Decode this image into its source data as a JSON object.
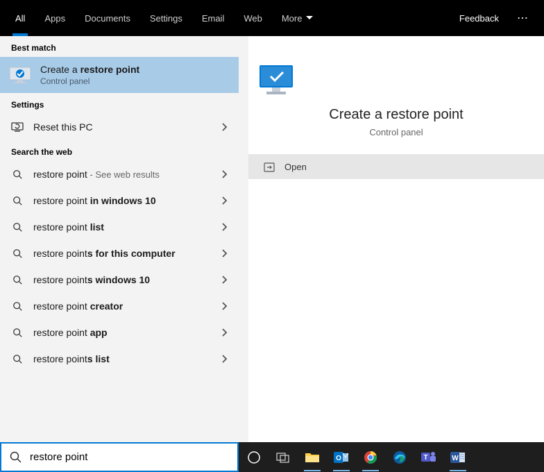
{
  "nav": {
    "tabs": [
      "All",
      "Apps",
      "Documents",
      "Settings",
      "Email",
      "Web",
      "More"
    ],
    "feedback": "Feedback"
  },
  "left": {
    "best_match_header": "Best match",
    "best_match": {
      "title_pre": "Create a ",
      "title_bold": "restore point",
      "subtitle": "Control panel"
    },
    "settings_header": "Settings",
    "settings_items": [
      {
        "label": "Reset this PC"
      }
    ],
    "web_header": "Search the web",
    "web_items": [
      {
        "pre": "restore point",
        "bold": "",
        "sub": " - See web results"
      },
      {
        "pre": "restore point ",
        "bold": "in windows 10",
        "sub": ""
      },
      {
        "pre": "restore point ",
        "bold": "list",
        "sub": ""
      },
      {
        "pre": "restore point",
        "bold": "s for this computer",
        "sub": ""
      },
      {
        "pre": "restore point",
        "bold": "s windows 10",
        "sub": ""
      },
      {
        "pre": "restore point ",
        "bold": "creator",
        "sub": ""
      },
      {
        "pre": "restore point ",
        "bold": "app",
        "sub": ""
      },
      {
        "pre": "restore point",
        "bold": "s list",
        "sub": ""
      }
    ]
  },
  "right": {
    "hero_title": "Create a restore point",
    "hero_subtitle": "Control panel",
    "open_label": "Open"
  },
  "search": {
    "value": "restore point"
  }
}
